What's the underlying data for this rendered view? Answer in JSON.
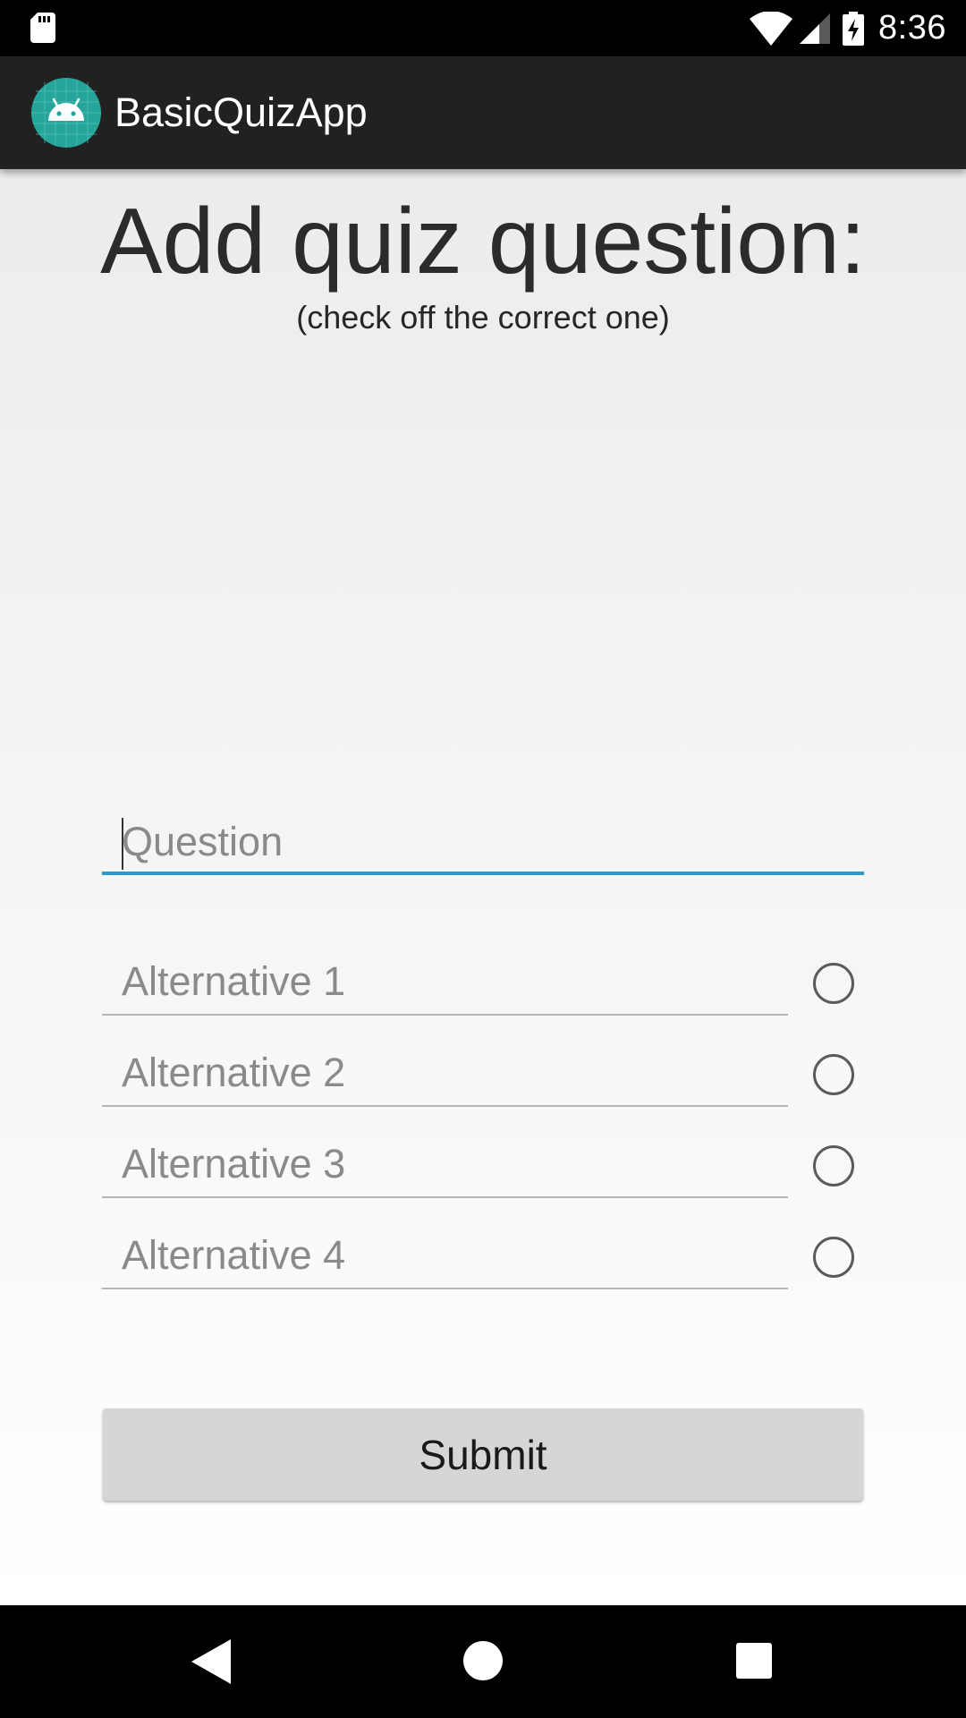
{
  "status_bar": {
    "time": "8:36",
    "icons": [
      "sd-card-icon",
      "wifi-icon",
      "cell-signal-icon",
      "battery-charging-icon"
    ]
  },
  "app_bar": {
    "title": "BasicQuizApp",
    "logo": "android-app-icon",
    "logo_color": "#26A69A"
  },
  "form": {
    "heading": "Add quiz question:",
    "subheading": "(check off the correct one)",
    "question_placeholder": "Question",
    "question_value": "",
    "alternatives": [
      {
        "placeholder": "Alternative 1",
        "value": "",
        "checked": false
      },
      {
        "placeholder": "Alternative 2",
        "value": "",
        "checked": false
      },
      {
        "placeholder": "Alternative 3",
        "value": "",
        "checked": false
      },
      {
        "placeholder": "Alternative 4",
        "value": "",
        "checked": false
      }
    ],
    "submit_label": "Submit"
  },
  "nav_bar": {
    "icons": [
      "back-icon",
      "home-icon",
      "recents-icon"
    ]
  },
  "colors": {
    "accent": "#2A9BC7",
    "app_bar": "#212121",
    "button": "#D6D6D6"
  }
}
